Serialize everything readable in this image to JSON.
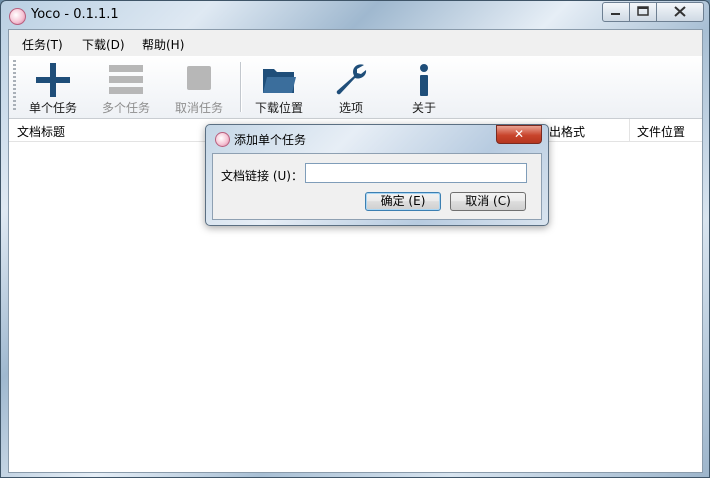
{
  "window": {
    "title": "Yoco - 0.1.1.1",
    "controls": {
      "minimize": "▭",
      "maximize": "□",
      "close": "✕"
    }
  },
  "menu": [
    {
      "label": "任务(T)"
    },
    {
      "label": "下载(D)"
    },
    {
      "label": "帮助(H)"
    }
  ],
  "toolbar": [
    {
      "label": "单个任务",
      "icon": "plus-icon",
      "enabled": true
    },
    {
      "label": "多个任务",
      "icon": "list-icon",
      "enabled": false
    },
    {
      "label": "取消任务",
      "icon": "stop-icon",
      "enabled": false
    },
    {
      "label": "下载位置",
      "icon": "folder-icon",
      "enabled": true
    },
    {
      "label": "选项",
      "icon": "wrench-icon",
      "enabled": true
    },
    {
      "label": "关于",
      "icon": "info-icon",
      "enabled": true
    }
  ],
  "list": {
    "columns": [
      "文档标题",
      "出格式",
      "文件位置"
    ],
    "rows": []
  },
  "dialog": {
    "title": "添加单个任务",
    "close": "✕",
    "url_label": "文档链接 (U)：",
    "url_value": "",
    "url_placeholder": "",
    "ok": "确定 (E)",
    "cancel": "取消 (C)"
  },
  "colors": {
    "accent": "#1f4e79",
    "disabled": "#b7b7b7",
    "close_red": "#c8442c"
  }
}
